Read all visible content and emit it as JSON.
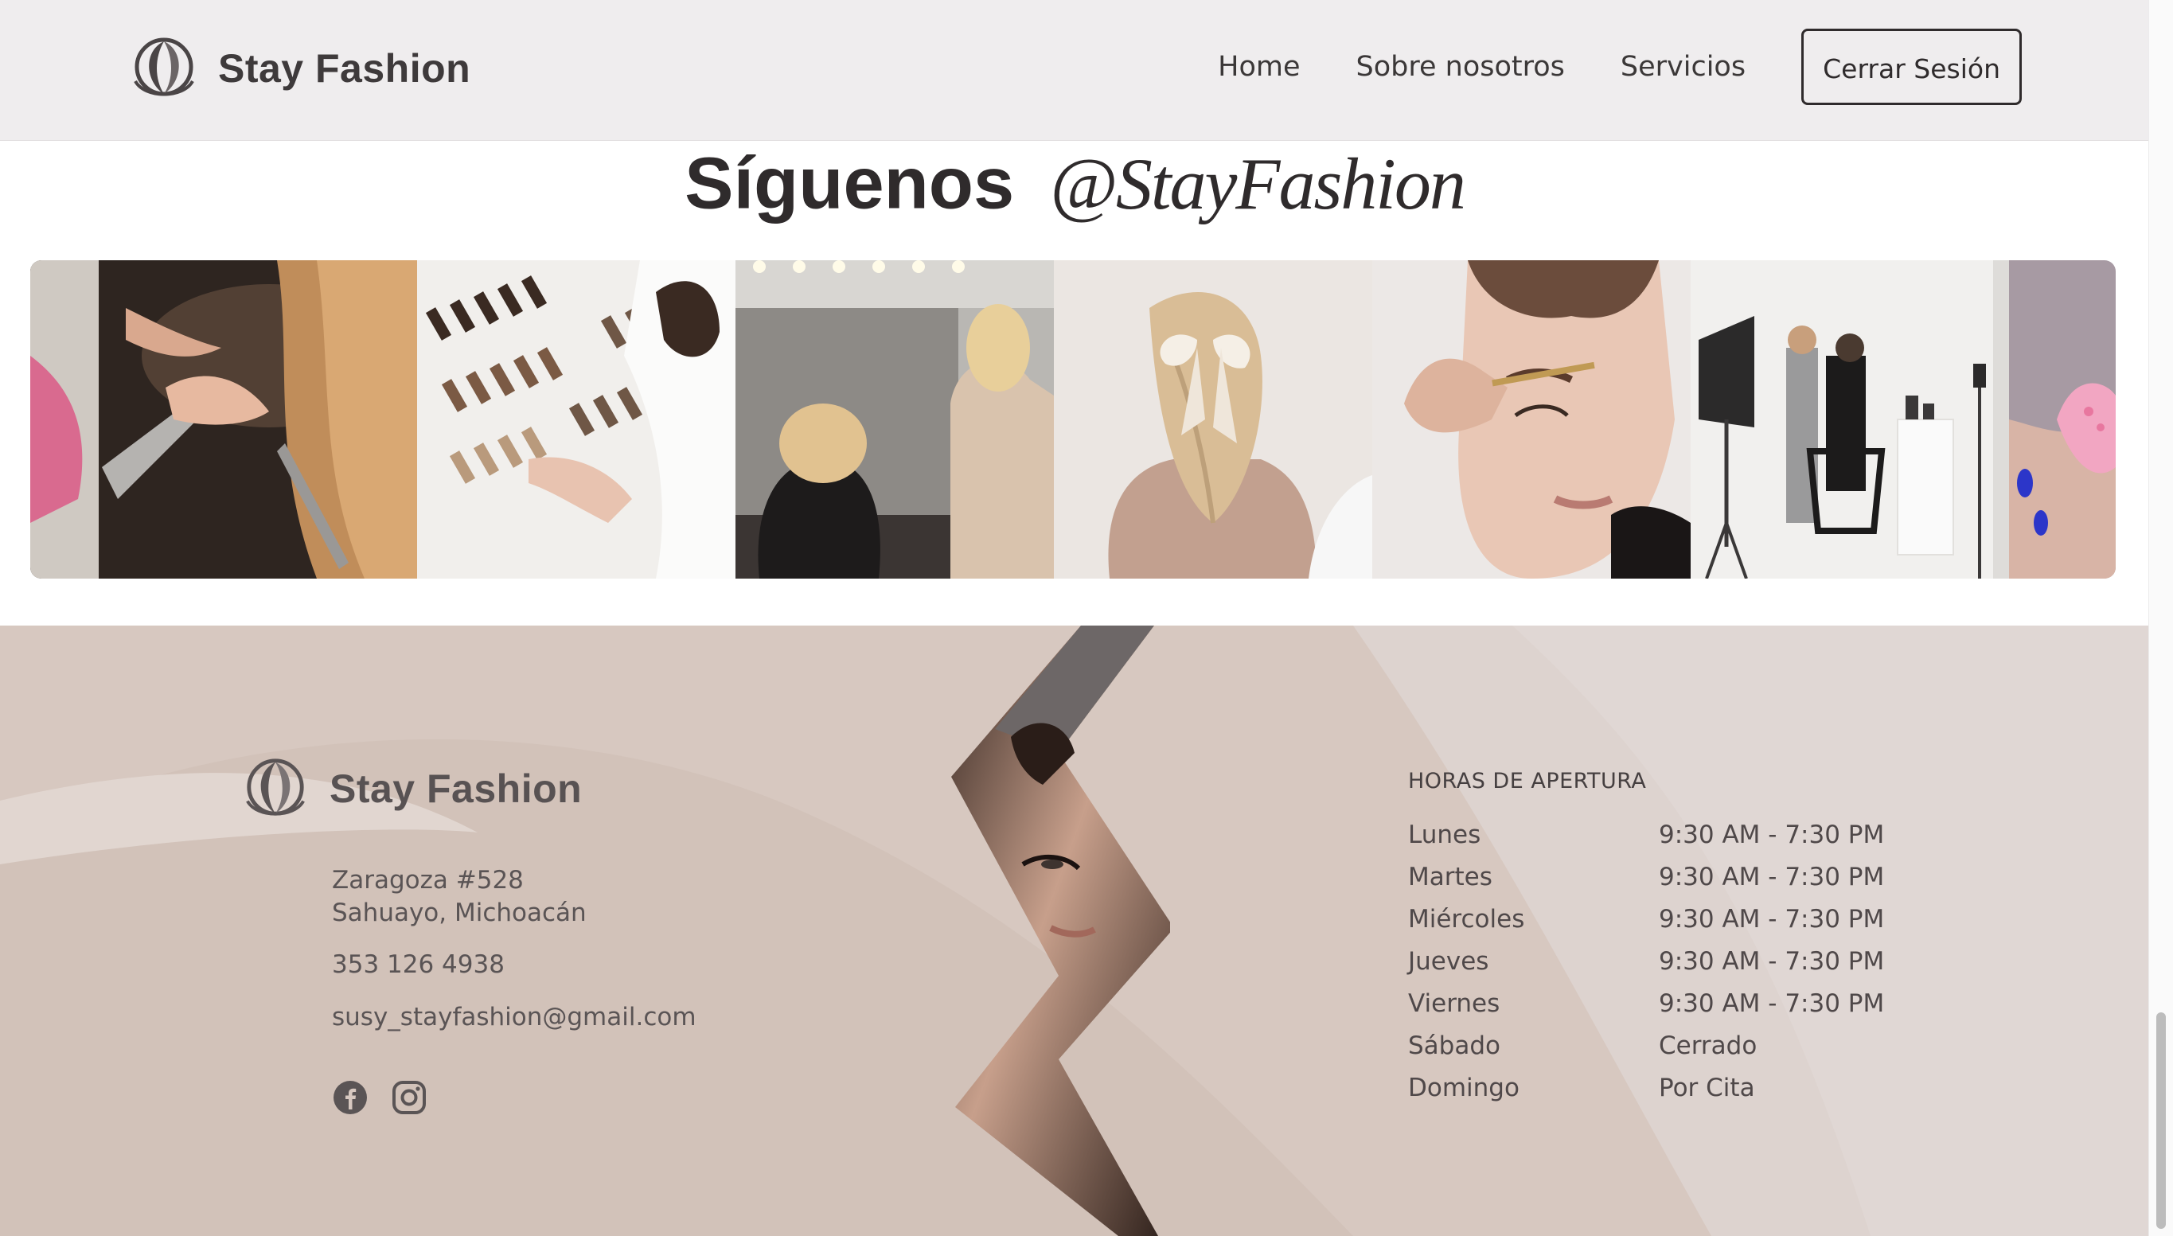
{
  "header": {
    "brand": "Stay Fashion",
    "nav": [
      "Home",
      "Sobre nosotros",
      "Servicios"
    ],
    "logout": "Cerrar Sesión"
  },
  "follow": {
    "title": "Síguenos",
    "handle": "@StayFashion"
  },
  "gallery": {
    "tiles": [
      "haircut-with-comb-and-scissors",
      "hair-color-swatches",
      "salon-hair-spray",
      "hair-bow-styling",
      "eyebrow-makeup",
      "studio-makeup-shoot",
      "pink-nail-art"
    ]
  },
  "footer": {
    "brand": "Stay Fashion",
    "address_line1": "Zaragoza #528",
    "address_line2": "Sahuayo, Michoacán",
    "phone": "353 126 4938",
    "email": "susy_stayfashion@gmail.com",
    "social": [
      "facebook-icon",
      "instagram-icon"
    ],
    "hours_title": "HORAS DE APERTURA",
    "hours": [
      {
        "day": "Lunes",
        "time": "9:30 AM - 7:30 PM"
      },
      {
        "day": "Martes",
        "time": "9:30 AM - 7:30 PM"
      },
      {
        "day": "Miércoles",
        "time": "9:30 AM - 7:30 PM"
      },
      {
        "day": "Jueves",
        "time": "9:30 AM - 7:30 PM"
      },
      {
        "day": "Viernes",
        "time": "9:30 AM - 7:30 PM"
      },
      {
        "day": "Sábado",
        "time": "Cerrado"
      },
      {
        "day": "Domingo",
        "time": "Por Cita"
      }
    ]
  },
  "colors": {
    "header_bg": "#efedee",
    "footer_bg": "#d8cac3",
    "text_dark": "#2f2b2c"
  }
}
